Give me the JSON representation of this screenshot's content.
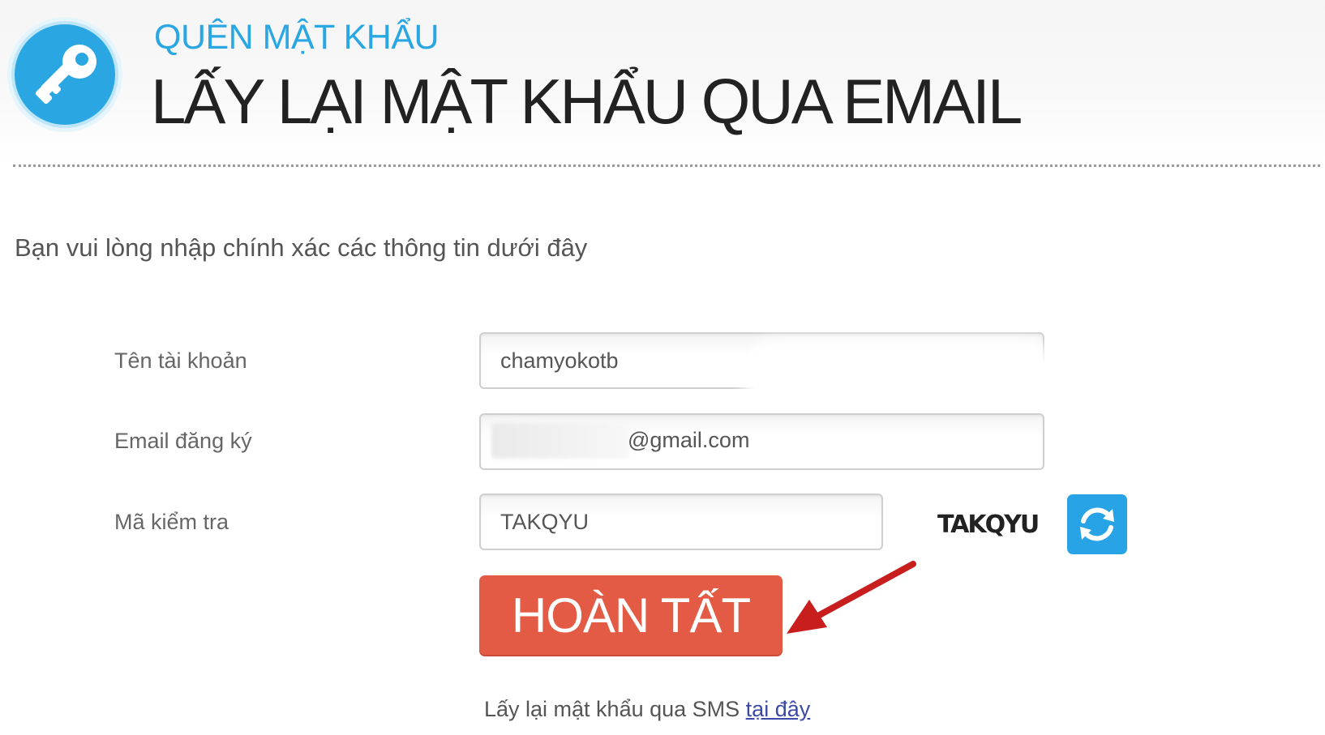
{
  "header": {
    "subtitle": "QUÊN MẬT KHẨU",
    "title": "LẤY LẠI MẬT KHẨU QUA EMAIL",
    "icon": "key-icon",
    "accent_color": "#2aa7e3"
  },
  "intro": "Bạn vui lòng nhập chính xác các thông tin dưới đây",
  "form": {
    "username": {
      "label": "Tên tài khoản",
      "value": "chamyokotb"
    },
    "email": {
      "label": "Email đăng ký",
      "value_visible": "@gmail.com"
    },
    "captcha": {
      "label": "Mã kiểm tra",
      "value": "TAKQYU",
      "image_text": "TAKQYU",
      "refresh_icon": "refresh-icon"
    },
    "submit_label": "HOÀN TẤT",
    "submit_color": "#e35a45"
  },
  "sms": {
    "text": "Lấy lại mật khẩu qua SMS ",
    "link": "tại đây",
    "link_color": "#3b49a7"
  }
}
